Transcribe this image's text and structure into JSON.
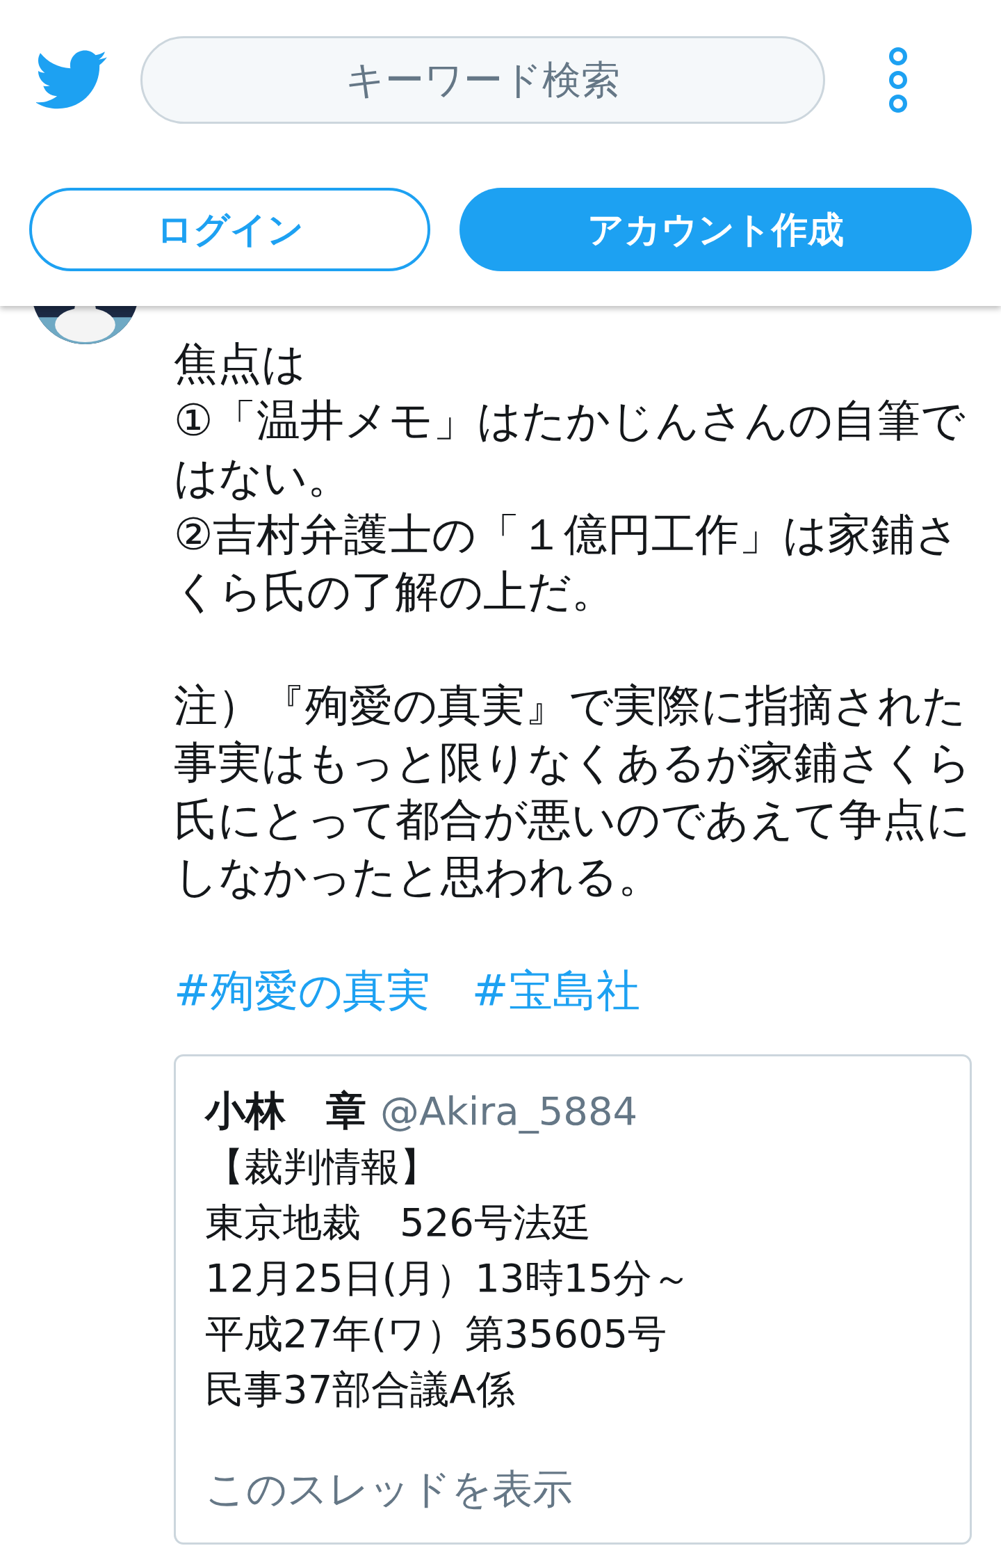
{
  "header": {
    "search": {
      "placeholder": "キーワード検索"
    },
    "buttons": [
      {
        "label": "ログイン",
        "kind": "outline"
      },
      {
        "label": "アカウント作成",
        "kind": "filled"
      }
    ]
  },
  "tweet": {
    "avatar": {
      "kind": "picture"
    },
    "paragraphs": [
      [
        "焦点は",
        "①「温井メモ」はたかじんさんの自筆で",
        "はない。",
        "②吉村弁護士の「１億円工作」は家鋪さ",
        "くら氏の了解の上だ。"
      ],
      [
        "注）『殉愛の真実』で実際に指摘された",
        "事実はもっと限りなくあるが家鋪さくら",
        "氏にとって都合が悪いのであえて争点に",
        "しなかったと思われる。"
      ]
    ],
    "hashtags": [
      "#殉愛の真実",
      "#宝島社"
    ],
    "quote": {
      "name": "小林　章",
      "handle": "@Akira_5884",
      "lines": [
        "【裁判情報】",
        "東京地裁　526号法廷",
        "12月25日(月）13時15分～",
        "平成27年(ワ）第35605号",
        "民事37部合議A係"
      ],
      "show_thread": "このスレッドを表示"
    }
  }
}
